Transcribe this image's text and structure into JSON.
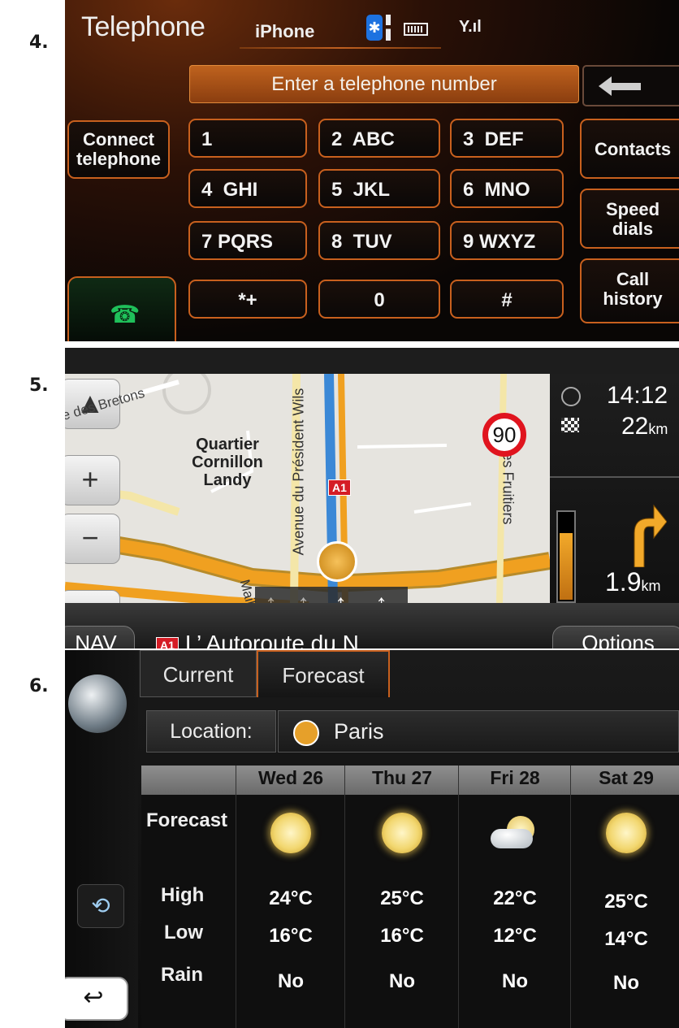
{
  "figure_numbers": [
    "4.",
    "5.",
    "6."
  ],
  "telephone": {
    "title": "Telephone",
    "device": "iPhone",
    "entry_prompt": "Enter a telephone number",
    "keys": [
      {
        "label": "1"
      },
      {
        "label": "2  ABC"
      },
      {
        "label": "3  DEF"
      },
      {
        "label": "4  GHI"
      },
      {
        "label": "5  JKL"
      },
      {
        "label": "6  MNO"
      },
      {
        "label": "7 PQRS"
      },
      {
        "label": "8  TUV"
      },
      {
        "label": "9 WXYZ"
      },
      {
        "label": "*+"
      },
      {
        "label": "0"
      },
      {
        "label": "#"
      }
    ],
    "connect_label": "Connect telephone",
    "contacts_label": "Contacts",
    "speed_dials_label": "Speed dials",
    "call_history_label": "Call history",
    "bluetooth_symbol": "✱",
    "signal_symbol": "Y.ıl",
    "accent_color": "#c8601e"
  },
  "navigation": {
    "speed_limit": "90",
    "street_labels": {
      "bretons": "rue des Bretons",
      "district": "Quartier Cornillon Landy",
      "wilson": "Avenue du Président Wils",
      "fruitiers": "rue des Fruitiers",
      "mail": "Mail de"
    },
    "motorway_badge": "A1",
    "zoom_in": "+",
    "zoom_out": "−",
    "arrival_time": "14:12",
    "remaining_distance": "22",
    "remaining_unit": "km",
    "next_turn_distance": "1.9",
    "next_turn_unit": "km",
    "nav_label": "NAV",
    "road_name": "L’ Autoroute du N",
    "options_label": "Options",
    "route_color": "#f0a020",
    "progress": 0.75
  },
  "weather": {
    "tab_current": "Current",
    "tab_forecast": "Forecast",
    "location_label": "Location:",
    "location": "Paris",
    "row_labels": {
      "forecast": "Forecast",
      "high": "High",
      "low": "Low",
      "rain": "Rain"
    },
    "days": [
      {
        "name": "Wed 26",
        "icon": "sun-icon",
        "high": "24°C",
        "low": "16°C",
        "rain": "No"
      },
      {
        "name": "Thu 27",
        "icon": "sun-icon",
        "high": "25°C",
        "low": "16°C",
        "rain": "No"
      },
      {
        "name": "Fri 28",
        "icon": "partly-cloudy-icon",
        "high": "22°C",
        "low": "12°C",
        "rain": "No"
      },
      {
        "name": "Sat 29",
        "icon": "sun-icon",
        "high": "25°C",
        "low": "14°C",
        "rain": "No"
      }
    ]
  }
}
